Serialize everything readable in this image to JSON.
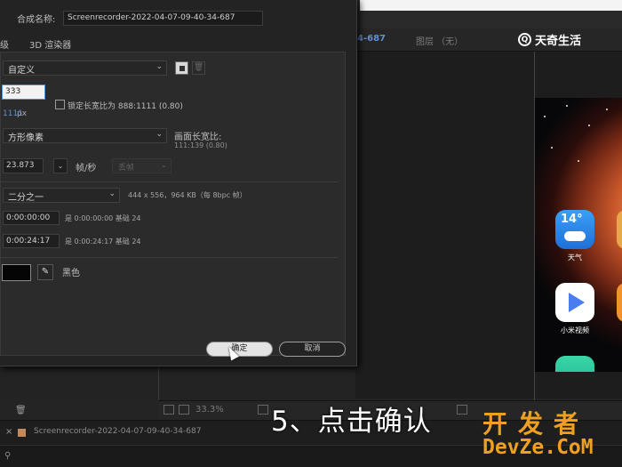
{
  "background": {
    "composition_tab": "4-687",
    "layer_tab": "图层 （无）",
    "brand_logo": "天奇生活",
    "zoom": "33.3%",
    "timeline_name": "Screenrecorder-2022-04-07-09-40-34-687",
    "phone_apps": {
      "weather_temp": "14°",
      "weather_label": "天气",
      "video_label": "小米视频"
    }
  },
  "dialog": {
    "name_label": "合成名称:",
    "name_value": "Screenrecorder-2022-04-07-09-40-34-687",
    "tabs": [
      "级",
      "3D 渲染器"
    ],
    "preset": "自定义",
    "width": "333",
    "height": "1111",
    "height_unit": "px",
    "lock_label": "锁定长宽比为 888:1111 (0.80)",
    "pixel_aspect": "方形像素",
    "frame_aspect_label": "画面长宽比:",
    "frame_aspect_value": "111:139 (0.80)",
    "fps": "23.873",
    "fps_label": "帧/秒",
    "drop_frame": "丢帧",
    "resolution": "二分之一",
    "resolution_info": "444 x 556，964 KB（每 8bpc 帧）",
    "start_timecode": "0:00:00:00",
    "start_note": "是 0:00:00:00  基础 24",
    "duration": "0:00:24:17",
    "duration_note": "是 0:00:24:17  基础 24",
    "bg_color_name": "黑色",
    "colors": {
      "bg_swatch": "#000000",
      "highlight": "#5a8fd8"
    },
    "ok_label": "确定",
    "cancel_label": "取消"
  },
  "caption": "5、点击确认",
  "watermark": {
    "line1": "开发者",
    "line2": "DevZe.CoM"
  }
}
